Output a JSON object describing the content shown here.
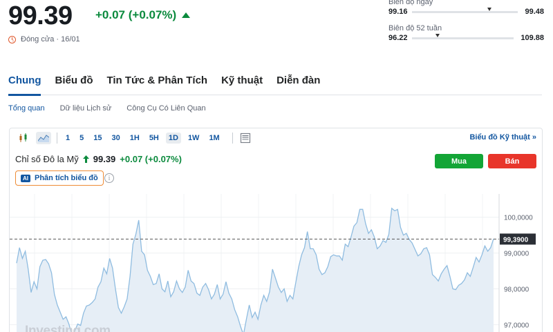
{
  "header": {
    "price": "99.39",
    "change": "+0.07 (+0.07%)",
    "status": "Đóng cửa · 16/01"
  },
  "ranges": {
    "day": {
      "title": "Biên độ ngày",
      "low": "99.16",
      "high": "99.48",
      "position": 0.71
    },
    "week52": {
      "title": "Biên độ 52 tuần",
      "low": "96.22",
      "high": "109.88",
      "position": 0.23
    }
  },
  "tabs": [
    "Chung",
    "Biểu đồ",
    "Tin Tức & Phân Tích",
    "Kỹ thuật",
    "Diễn đàn"
  ],
  "subtabs": [
    "Tổng quan",
    "Dữ liệu Lịch sử",
    "Công Cụ Có Liên Quan"
  ],
  "toolbar": {
    "intervals": [
      "1",
      "5",
      "15",
      "30",
      "1H",
      "5H",
      "1D",
      "1W",
      "1M"
    ],
    "active_interval": "1D",
    "advanced_link": "Biểu đồ Kỹ thuật »"
  },
  "instrument": {
    "name": "Chỉ số Đô la Mỹ",
    "price": "99.39",
    "change": "+0.07 (+0.07%)",
    "buy_label": "Mua",
    "sell_label": "Bán",
    "ai_badge": "AI",
    "ai_label": "Phân tích biểu đồ",
    "info_glyph": "i"
  },
  "colors": {
    "accent": "#1256a0",
    "up": "#0b8a3d",
    "buy": "#13a536",
    "sell": "#e8352a",
    "line": "#8fbce0",
    "area": "#e6eef6"
  },
  "chart_data": {
    "type": "area",
    "y_ticks": [
      "100,0000",
      "99,0000",
      "98,0000",
      "97,0000"
    ],
    "y_tick_values": [
      100,
      99,
      98,
      97
    ],
    "ylim": [
      96.7,
      100.65
    ],
    "current_label": "99,3900",
    "current_value": 99.39,
    "watermark": "Investing.com",
    "values": [
      98.72,
      99.15,
      98.85,
      99.05,
      98.55,
      97.9,
      98.2,
      98.0,
      98.62,
      98.8,
      98.82,
      98.7,
      98.45,
      97.85,
      97.55,
      97.35,
      97.15,
      97.22,
      97.02,
      96.72,
      96.82,
      97.02,
      96.98,
      97.32,
      97.52,
      97.55,
      97.62,
      97.72,
      98.05,
      98.2,
      98.58,
      98.42,
      98.85,
      98.58,
      98.0,
      97.48,
      97.32,
      97.5,
      97.72,
      98.35,
      99.25,
      99.52,
      99.92,
      99.05,
      98.95,
      98.52,
      98.35,
      98.12,
      98.15,
      98.42,
      98.0,
      97.92,
      98.22,
      97.78,
      97.92,
      98.22,
      98.0,
      97.9,
      98.05,
      98.52,
      98.22,
      98.15,
      97.88,
      97.82,
      98.05,
      98.15,
      97.98,
      97.72,
      97.85,
      98.12,
      97.72,
      97.85,
      98.2,
      97.88,
      97.72,
      97.42,
      97.22,
      96.95,
      96.72,
      97.15,
      97.55,
      97.2,
      97.35,
      97.15,
      97.55,
      97.82,
      97.65,
      97.92,
      98.55,
      98.3,
      98.05,
      97.9,
      98.0,
      97.65,
      97.82,
      97.72,
      98.18,
      98.62,
      98.95,
      99.15,
      99.6,
      99.12,
      99.12,
      98.95,
      98.55,
      98.4,
      98.45,
      98.62,
      98.9,
      98.95,
      98.92,
      98.92,
      98.8,
      99.25,
      99.18,
      99.45,
      99.75,
      99.85,
      100.22,
      100.22,
      99.82,
      99.55,
      99.65,
      99.45,
      99.12,
      99.2,
      99.35,
      99.3,
      99.52,
      100.25,
      100.18,
      100.22,
      99.72,
      99.5,
      99.55,
      99.38,
      99.28,
      99.1,
      98.92,
      98.98,
      99.12,
      99.15,
      98.95,
      98.4,
      98.32,
      98.22,
      98.42,
      98.55,
      98.65,
      98.35,
      98.0,
      97.98,
      98.1,
      98.15,
      98.25,
      98.45,
      98.35,
      98.6,
      98.88,
      98.75,
      98.95,
      99.2,
      99.05,
      99.15,
      99.4
    ]
  }
}
